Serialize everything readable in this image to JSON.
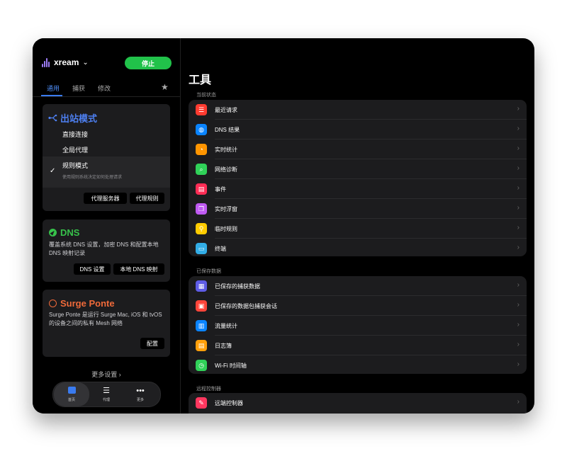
{
  "app": {
    "name": "xream",
    "stop_label": "停止"
  },
  "tabs": [
    {
      "label": "通用"
    },
    {
      "label": "捕获"
    },
    {
      "label": "修改"
    }
  ],
  "outbound": {
    "title": "出站模式",
    "modes": [
      {
        "label": "直接连接"
      },
      {
        "label": "全局代理"
      },
      {
        "label": "规则模式"
      }
    ],
    "selected_desc": "使用规则系统决定如何处理请求",
    "buttons": [
      "代理服务器",
      "代理规则"
    ]
  },
  "dns": {
    "title": "DNS",
    "desc": "覆盖系统 DNS 设置，加密 DNS 和配置本地 DNS 映射记录",
    "buttons": [
      "DNS 设置",
      "本地 DNS 映射"
    ]
  },
  "ponte": {
    "title": "Surge Ponte",
    "desc": "Surge Ponte 是运行 Surge Mac, iOS 和 tvOS 的设备之间的私有 Mesh 网络",
    "button": "配置"
  },
  "more_settings": "更多设置 ›",
  "bottom_nav": [
    {
      "label": "首页",
      "icon": "home-icon"
    },
    {
      "label": "代理",
      "icon": "list-icon"
    },
    {
      "label": "更多",
      "icon": "more-icon"
    }
  ],
  "main": {
    "title": "工具",
    "sections": [
      {
        "header": "当前状态",
        "items": [
          {
            "label": "最近请求",
            "icon": "list-icon",
            "color": "#ff3b30"
          },
          {
            "label": "DNS 结果",
            "icon": "globe-icon",
            "color": "#0a84ff"
          },
          {
            "label": "实时统计",
            "icon": "gauge-icon",
            "color": "#ff9500"
          },
          {
            "label": "网络诊断",
            "icon": "magnifier-icon",
            "color": "#30d158"
          },
          {
            "label": "事件",
            "icon": "document-icon",
            "color": "#ff2d55"
          },
          {
            "label": "实时浮窗",
            "icon": "window-icon",
            "color": "#bf5af2"
          },
          {
            "label": "临时规则",
            "icon": "pin-icon",
            "color": "#ffcc00"
          },
          {
            "label": "终端",
            "icon": "terminal-icon",
            "color": "#32ade6"
          }
        ]
      },
      {
        "header": "已保存数据",
        "items": [
          {
            "label": "已保存的捕获数据",
            "icon": "archive-icon",
            "color": "#5e5ce6"
          },
          {
            "label": "已保存的数据包捕获会话",
            "icon": "package-icon",
            "color": "#ff453a"
          },
          {
            "label": "流量统计",
            "icon": "chart-icon",
            "color": "#0a84ff"
          },
          {
            "label": "日志簿",
            "icon": "book-icon",
            "color": "#ff9f0a"
          },
          {
            "label": "Wi-Fi 时间轴",
            "icon": "clock-icon",
            "color": "#30d158"
          }
        ]
      },
      {
        "header": "远程控制器",
        "items": [
          {
            "label": "远端控制器",
            "icon": "remote-icon",
            "color": "#ff375f"
          }
        ]
      }
    ]
  },
  "colors": {
    "accent_blue": "#3a7bf0",
    "stop_green": "#21c24a",
    "dns_green": "#37c24b",
    "ponte_orange": "#f06a3a"
  }
}
